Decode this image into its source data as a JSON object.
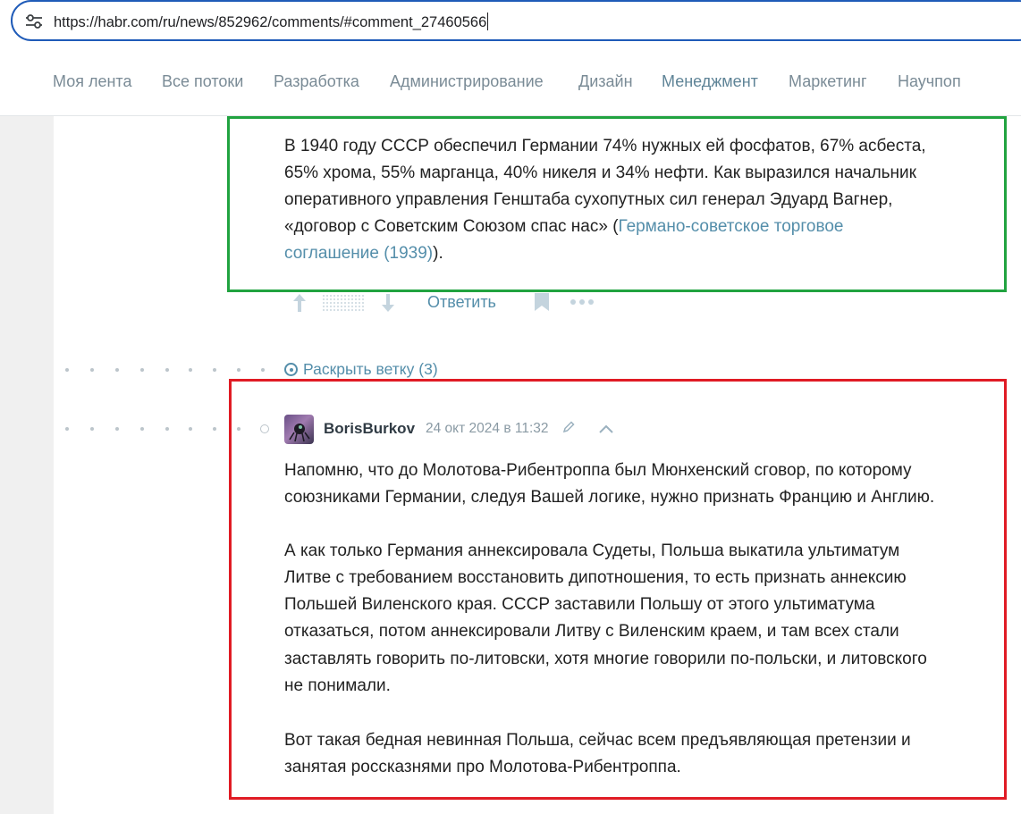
{
  "browser": {
    "url": "https://habr.com/ru/news/852962/comments/#comment_27460566",
    "site_info_icon": "tune-icon"
  },
  "nav": {
    "items": [
      {
        "label": "Моя лента"
      },
      {
        "label": "Все потоки"
      },
      {
        "label": "Разработка"
      },
      {
        "label": "Администрирование"
      },
      {
        "label": "Дизайн"
      },
      {
        "label": "Менеджмент",
        "active": true
      },
      {
        "label": "Маркетинг"
      },
      {
        "label": "Научпоп"
      }
    ]
  },
  "comment1": {
    "lines": [
      "В 1940 году СССР обеспечил Германии 74% нужных ей фосфатов, 67% асбеста,",
      "65% хрома, 55% марганца, 40% никеля и 34% нефти. Как выразился начальник",
      "оперативного управления Генштаба сухопутных сил генерал Эдуард Вагнер,"
    ],
    "line4_text": "«договор с Советским Союзом спас нас» (",
    "link_part1": "Германо-советское торговое",
    "link_part2": "соглашение (1939)",
    "line5_tail": ")."
  },
  "actions": {
    "reply_label": "Ответить",
    "icons": [
      "upvote-arrow-icon",
      "rating-placeholder",
      "downvote-arrow-icon",
      "bookmark-icon",
      "more-icon"
    ]
  },
  "thread": {
    "expand_label": "Раскрыть ветку (3)"
  },
  "comment2": {
    "author": "BorisBurkov",
    "date": "24 окт 2024 в 11:32",
    "paragraphs": [
      [
        "Напомню, что до Молотова-Рибентроппа был Мюнхенский сговор, по которому",
        "союзниками Германии, следуя Вашей логике, нужно признать Францию и Англию."
      ],
      [
        "А как только Германия аннексировала Судеты, Польша выкатила ультиматум",
        "Литве с требованием восстановить дипотношения, то есть признать аннексию",
        "Польшей Виленского края. СССР заставили Польшу от этого ультиматума",
        "отказаться, потом аннексировали Литву с Виленским краем, и там всех стали",
        "заставлять говорить по-литовски, хотя многие говорили по-польски, и литовского",
        "не понимали."
      ],
      [
        "Вот такая бедная невинная Польша, сейчас всем предъявляющая претензии и",
        "занятая россказнями про Молотова-Рибентроппа."
      ]
    ]
  },
  "colors": {
    "link": "#548eaa",
    "highlight_green": "#21a340",
    "highlight_red": "#e01b24",
    "nav_text": "#7a8b96"
  }
}
